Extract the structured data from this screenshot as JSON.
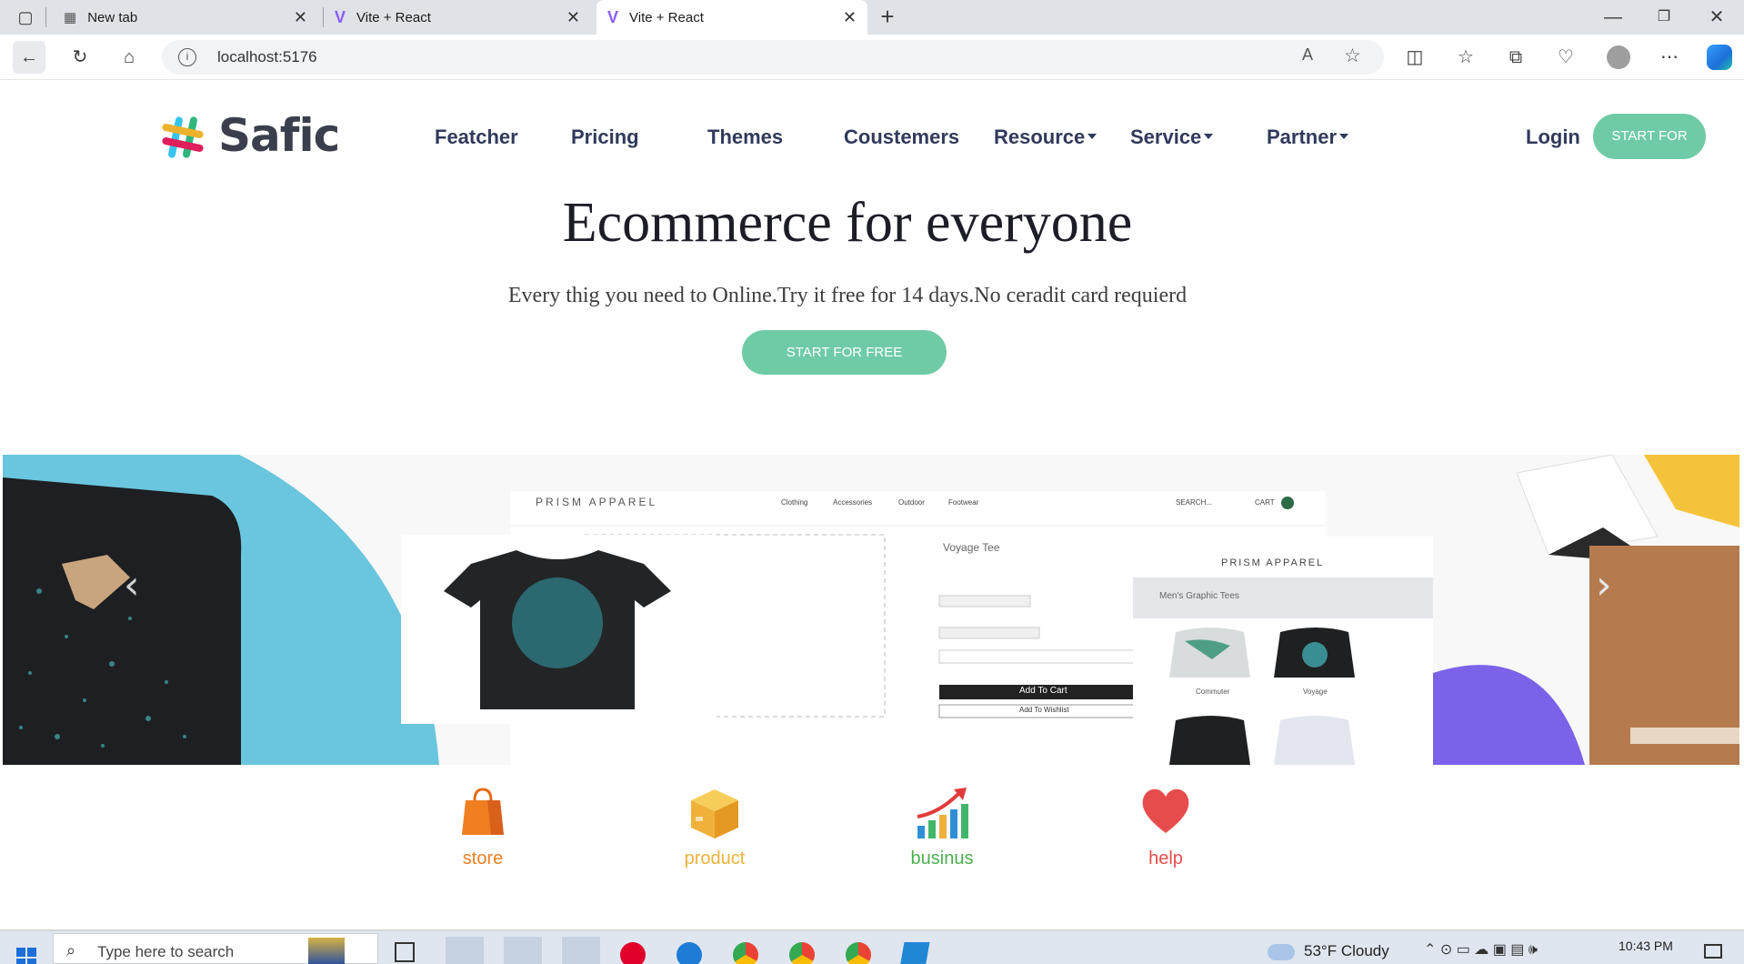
{
  "browser": {
    "tabs": [
      {
        "title": "New tab",
        "active": false
      },
      {
        "title": "Vite + React",
        "active": false
      },
      {
        "title": "Vite + React",
        "active": true
      }
    ],
    "new_tab_label": "+",
    "url": "localhost:5176"
  },
  "site": {
    "logo_text": "Safic",
    "nav": [
      {
        "label": "Featcher",
        "dropdown": false
      },
      {
        "label": "Pricing",
        "dropdown": false
      },
      {
        "label": "Themes",
        "dropdown": false
      },
      {
        "label": "Coustemers",
        "dropdown": false
      },
      {
        "label": "Resource",
        "dropdown": true
      },
      {
        "label": "Service",
        "dropdown": true
      },
      {
        "label": "Partner",
        "dropdown": true
      }
    ],
    "login_label": "Login",
    "header_cta": "START FOR FREE",
    "hero": {
      "title": "Ecommerce for everyone",
      "subtitle": "Every thig you need to Online.Try it free for 14 days.No ceradit card requierd",
      "cta": "START FOR FREE"
    },
    "banner": {
      "store_name": "PRISM APPAREL",
      "menu": [
        "Clothing",
        "Accessories",
        "Outdoor",
        "Footwear"
      ],
      "search_label": "SEARCH...",
      "cart_label": "CART",
      "product_name": "Voyage Tee",
      "add_to_cart": "Add To Cart",
      "add_to_wishlist": "Add To Wishlist",
      "mobile_category": "Men's Graphic Tees",
      "mobile_items": [
        "Commuter",
        "Voyage"
      ]
    },
    "features": [
      {
        "label": "store",
        "icon": "shopping-bag-icon",
        "color": "#f07f22"
      },
      {
        "label": "product",
        "icon": "box-icon",
        "color": "#f0b13a"
      },
      {
        "label": "businus",
        "icon": "growth-chart-icon",
        "color": "#4caf50"
      },
      {
        "label": "help",
        "icon": "heart-icon",
        "color": "#e74c4c"
      }
    ],
    "colors": {
      "accent": "#6fcba6",
      "nav_text": "#313a5b",
      "banner_blue": "#69c6de",
      "banner_purple": "#7b62e8",
      "banner_yellow": "#f5c33b"
    }
  },
  "taskbar": {
    "search_placeholder": "Type here to search",
    "weather": "53°F  Cloudy",
    "time": "10:43 PM"
  }
}
